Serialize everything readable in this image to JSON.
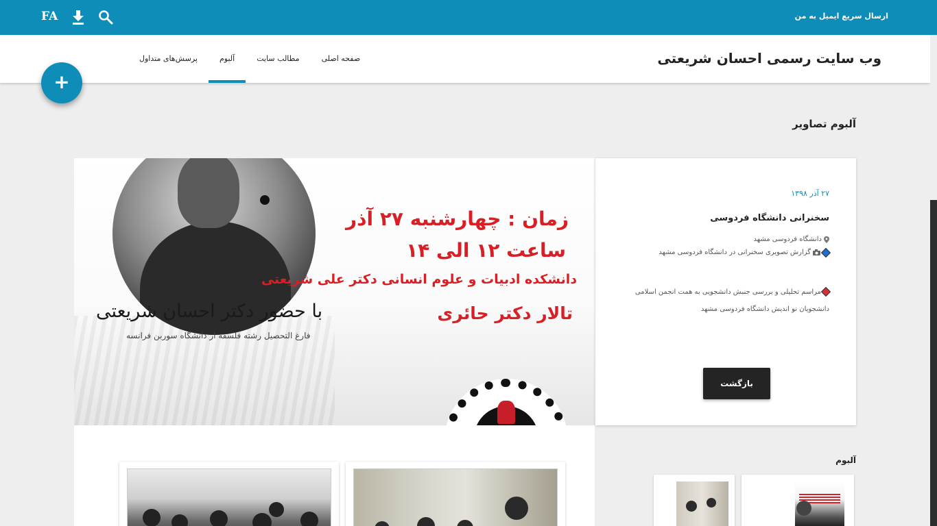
{
  "topbar": {
    "email_link": "ارسال سریع ایمیل به من",
    "language": "FA",
    "icons": [
      "download-icon",
      "search-icon"
    ]
  },
  "header": {
    "site_title": "وب سایت رسمی احسان شریعتی",
    "nav": [
      {
        "label": "صفحه اصلی",
        "active": false
      },
      {
        "label": "مطالب سایت",
        "active": false
      },
      {
        "label": "آلبوم",
        "active": true
      },
      {
        "label": "پرسش‌های متداول",
        "active": false
      }
    ],
    "fab_label": "+"
  },
  "colors": {
    "primary": "#0e8db8",
    "poster_red": "#d81f26",
    "button_dark": "#242424"
  },
  "main": {
    "section_title": "آلبوم تصاویر",
    "poster": {
      "line1": "زمان : چهارشنبه ۲۷ آذر",
      "line2": "ساعت ۱۲ الی ۱۴",
      "line3": "دانشکده ادبیات و علوم انسانی دکتر علی شریعتی",
      "line4": "تالار دکتر حائری",
      "guest": "با حضور دکتر احسان شریعتی",
      "guest_sub": "فارغ التحصیل رشته فلسفه از دانشگاه سوربن فرانسه"
    },
    "info": {
      "date": "۲۷ آذر ۱۳۹۸",
      "title": "سخنرانی دانشگاه فردوسی",
      "location": "دانشگاه فردوسی مشهد",
      "report": "گزارش تصویری سخنرانی در دانشگاه فردوسی مشهد",
      "desc_line1": "مراسم تحلیلی و بررسی جنبش دانشجویی   به همت انجمن اسلامی",
      "desc_line2": "دانشجویان نو اندیش دانشگاه فردوسی مشهد",
      "back_button": "بازگشت"
    }
  },
  "sidebar": {
    "album_title": "آلبوم"
  }
}
